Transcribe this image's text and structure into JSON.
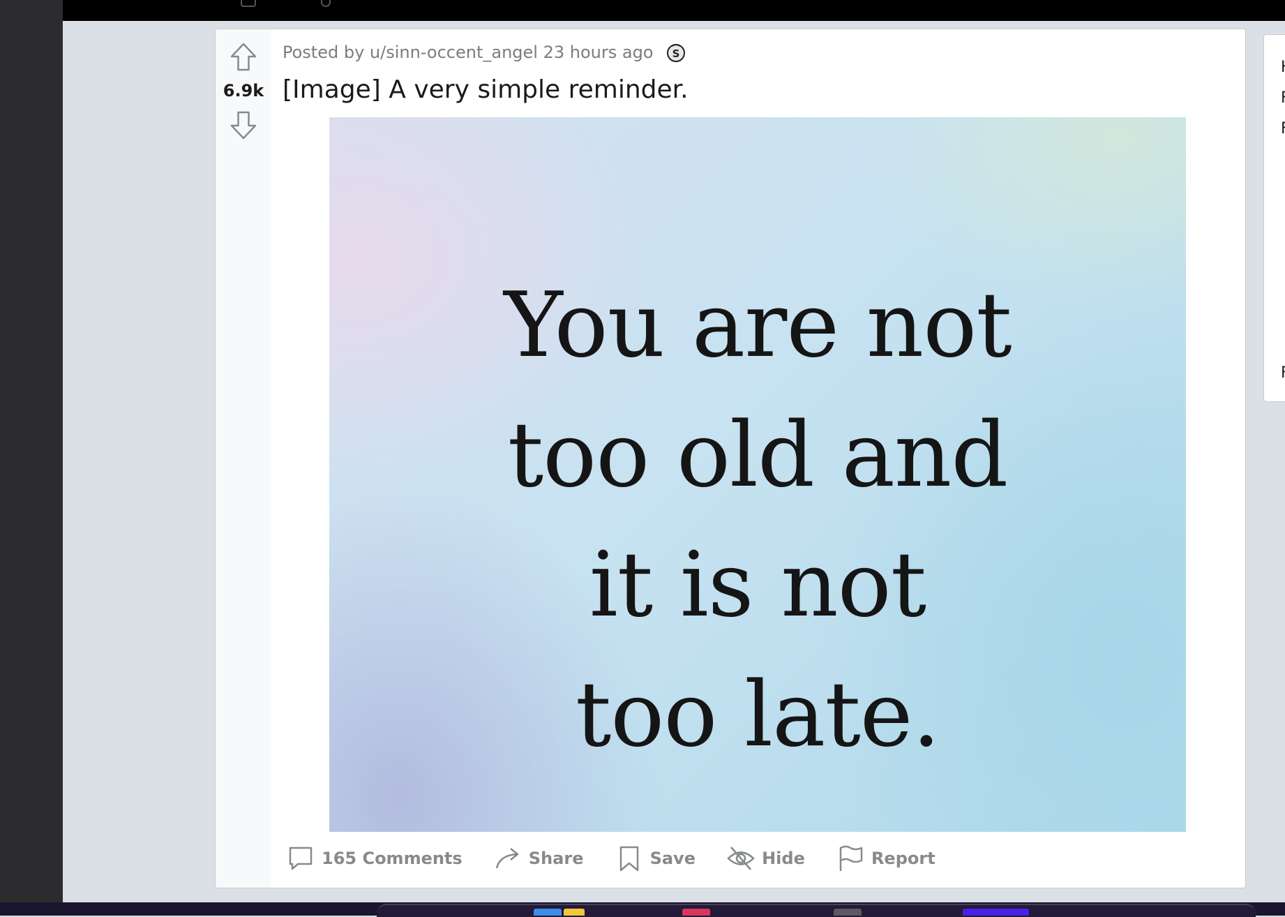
{
  "post": {
    "score": "6.9k",
    "meta": "Posted by u/sinn-occent_angel 23 hours ago",
    "award_icon": "silver-award-icon",
    "title": "[Image] A very simple reminder.",
    "image_text": [
      "You are not",
      "too old and",
      "it is not",
      "too late."
    ]
  },
  "actions": [
    {
      "icon": "comment-icon",
      "label": "165 Comments"
    },
    {
      "icon": "share-icon",
      "label": "Share"
    },
    {
      "icon": "bookmark-icon",
      "label": "Save"
    },
    {
      "icon": "eye-slash-icon",
      "label": "Hide"
    },
    {
      "icon": "flag-icon",
      "label": "Report"
    }
  ],
  "sidebar": {
    "fragments": [
      "H",
      "F",
      "F",
      "F"
    ]
  },
  "colors": {
    "page_bg": "#dae0e6",
    "card_bg": "#ffffff",
    "vote_column_bg": "#f8f9fa",
    "meta_text": "#7c7c7c",
    "action_text": "#878a8c"
  }
}
